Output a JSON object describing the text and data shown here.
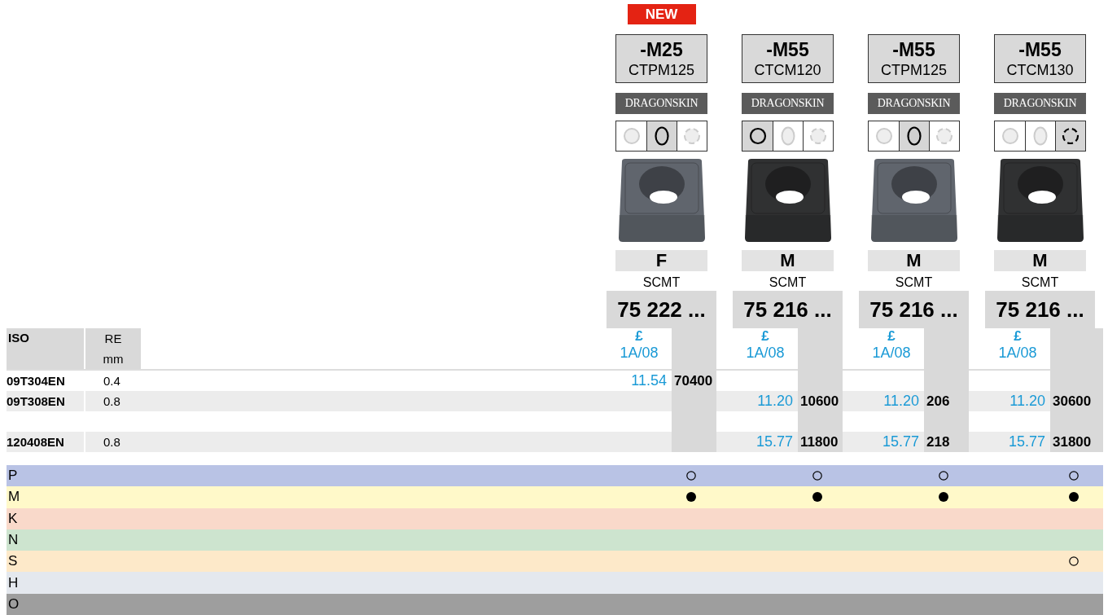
{
  "products": [
    {
      "badge": "NEW",
      "chipbreaker": "-M25",
      "grade": "CTPM125",
      "coating": "DRAGONSKIN",
      "geometry_icons": [
        {
          "kind": "round",
          "selected": false
        },
        {
          "kind": "oval",
          "selected": true
        },
        {
          "kind": "dashed",
          "selected": false
        }
      ],
      "color": "#60656d",
      "application": "F",
      "shape": "SCMT",
      "order_code": "75 222 ...",
      "currency": "£",
      "price_group": "1A/08"
    },
    {
      "chipbreaker": "-M55",
      "grade": "CTCM120",
      "coating": "DRAGONSKIN",
      "geometry_icons": [
        {
          "kind": "round",
          "selected": true
        },
        {
          "kind": "oval",
          "selected": false
        },
        {
          "kind": "dashed",
          "selected": false
        }
      ],
      "color": "#303132",
      "application": "M",
      "shape": "SCMT",
      "order_code": "75 216 ...",
      "currency": "£",
      "price_group": "1A/08"
    },
    {
      "chipbreaker": "-M55",
      "grade": "CTPM125",
      "coating": "DRAGONSKIN",
      "geometry_icons": [
        {
          "kind": "round",
          "selected": false
        },
        {
          "kind": "oval",
          "selected": true
        },
        {
          "kind": "dashed",
          "selected": false
        }
      ],
      "color": "#60656d",
      "application": "M",
      "shape": "SCMT",
      "order_code": "75 216 ...",
      "currency": "£",
      "price_group": "1A/08"
    },
    {
      "chipbreaker": "-M55",
      "grade": "CTCM130",
      "coating": "DRAGONSKIN",
      "geometry_icons": [
        {
          "kind": "round",
          "selected": false
        },
        {
          "kind": "oval",
          "selected": false
        },
        {
          "kind": "dashed",
          "selected": true
        }
      ],
      "color": "#303132",
      "application": "M",
      "shape": "SCMT",
      "order_code": "75 216 ...",
      "currency": "£",
      "price_group": "1A/08"
    }
  ],
  "table": {
    "columns": [
      {
        "label": "ISO"
      },
      {
        "label": "RE",
        "unit": "mm"
      }
    ],
    "rows": [
      {
        "kind": "item",
        "iso": "09T304EN",
        "re": "0.4",
        "cells": [
          {
            "kind": "value",
            "price": "11.54",
            "stock": "70400"
          },
          {
            "kind": "blank"
          },
          {
            "kind": "blank"
          },
          {
            "kind": "blank"
          }
        ]
      },
      {
        "kind": "item",
        "iso": "09T308EN",
        "re": "0.8",
        "cells": [
          {
            "kind": "blank"
          },
          {
            "kind": "value",
            "price": "11.20",
            "stock": "10600"
          },
          {
            "kind": "value",
            "price": "11.20",
            "stock": "206"
          },
          {
            "kind": "value",
            "price": "11.20",
            "stock": "30600"
          }
        ]
      },
      {
        "kind": "blank"
      },
      {
        "kind": "item",
        "iso": "120408EN",
        "re": "0.8",
        "cells": [
          {
            "kind": "blank"
          },
          {
            "kind": "value",
            "price": "15.77",
            "stock": "11800"
          },
          {
            "kind": "value",
            "price": "15.77",
            "stock": "218"
          },
          {
            "kind": "value",
            "price": "15.77",
            "stock": "31800"
          }
        ]
      }
    ]
  },
  "materials": [
    {
      "label": "P",
      "color": "#b9c3e5",
      "marks": [
        {
          "kind": "open"
        },
        {
          "kind": "open"
        },
        {
          "kind": "open"
        },
        {
          "kind": "open"
        }
      ]
    },
    {
      "label": "M",
      "color": "#fff9c9",
      "marks": [
        {
          "kind": "filled"
        },
        {
          "kind": "filled"
        },
        {
          "kind": "filled"
        },
        {
          "kind": "filled"
        }
      ]
    },
    {
      "label": "K",
      "color": "#f9d9ca",
      "marks": [
        {
          "kind": "none"
        },
        {
          "kind": "none"
        },
        {
          "kind": "none"
        },
        {
          "kind": "none"
        }
      ]
    },
    {
      "label": "N",
      "color": "#cde4cf",
      "marks": [
        {
          "kind": "none"
        },
        {
          "kind": "none"
        },
        {
          "kind": "none"
        },
        {
          "kind": "none"
        }
      ]
    },
    {
      "label": "S",
      "color": "#fde9c9",
      "marks": [
        {
          "kind": "none"
        },
        {
          "kind": "none"
        },
        {
          "kind": "none"
        },
        {
          "kind": "open"
        }
      ]
    },
    {
      "label": "H",
      "color": "#e4e8ee",
      "marks": [
        {
          "kind": "none"
        },
        {
          "kind": "none"
        },
        {
          "kind": "none"
        },
        {
          "kind": "none"
        }
      ]
    },
    {
      "label": "O",
      "color": "#9e9e9e",
      "marks": [
        {
          "kind": "none"
        },
        {
          "kind": "none"
        },
        {
          "kind": "none"
        },
        {
          "kind": "none"
        }
      ]
    }
  ]
}
